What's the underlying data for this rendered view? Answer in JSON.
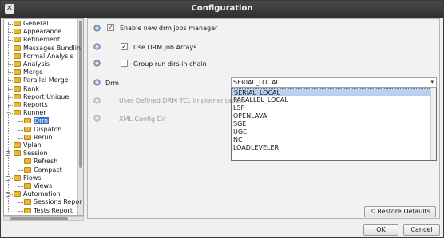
{
  "window": {
    "title": "Configuration"
  },
  "tree": {
    "items": [
      {
        "label": "General"
      },
      {
        "label": "Appearance"
      },
      {
        "label": "Refinement"
      },
      {
        "label": "Messages Bundlin"
      },
      {
        "label": "Formal Analysis"
      },
      {
        "label": "Analysis"
      },
      {
        "label": "Merge"
      },
      {
        "label": "Parallel Merge"
      },
      {
        "label": "Rank"
      },
      {
        "label": "Report Unique"
      },
      {
        "label": "Reports"
      },
      {
        "label": "Runner"
      },
      {
        "label": "Drm",
        "selected": true
      },
      {
        "label": "Dispatch"
      },
      {
        "label": "Rerun"
      },
      {
        "label": "Vplan"
      },
      {
        "label": "Session"
      },
      {
        "label": "Refresh"
      },
      {
        "label": "Compact"
      },
      {
        "label": "Flows"
      },
      {
        "label": "Views"
      },
      {
        "label": "Automation"
      },
      {
        "label": "Sessions Repor"
      },
      {
        "label": "Tests Report"
      }
    ]
  },
  "settings": {
    "enable_drm": {
      "label": "Enable new drm jobs manager",
      "checked": true
    },
    "use_arrays": {
      "label": "Use DRM Job Arrays",
      "checked": true
    },
    "group_dirs": {
      "label": "Group run dirs in chain",
      "checked": false
    },
    "drm": {
      "label": "Drm",
      "value": "SERIAL_LOCAL"
    },
    "tcl_impl": {
      "label": "User Defined DRM TCL implementation"
    },
    "xml_dir": {
      "label": "XML Config Dir"
    }
  },
  "dropdown": {
    "options": [
      "SERIAL_LOCAL",
      "PARALLEL_LOCAL",
      "LSF",
      "OPENLAVA",
      "SGE",
      "UGE",
      "NC",
      "LOADLEVELER"
    ]
  },
  "buttons": {
    "restore": "Restore Defaults",
    "ok": "OK",
    "cancel": "Cancel"
  },
  "icons": {
    "close": "close-icon",
    "folder": "folder-icon",
    "gear": "gear-icon"
  },
  "colors": {
    "titlebar": "#363636",
    "selection": "#3a6fc4",
    "folder": "#e8b92f",
    "dropdown_highlight": "#b9cfee"
  }
}
